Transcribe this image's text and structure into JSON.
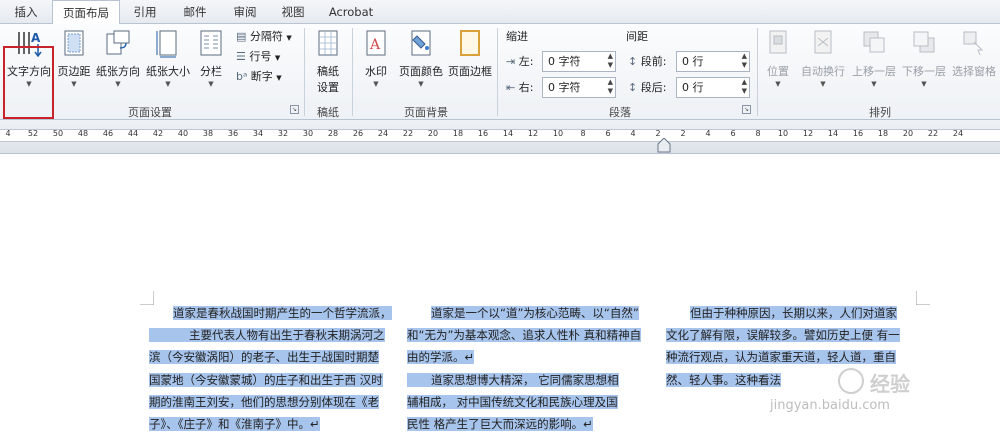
{
  "tabs": [
    "插入",
    "页面布局",
    "引用",
    "邮件",
    "审阅",
    "视图",
    "Acrobat"
  ],
  "active_tab": "页面布局",
  "page_setup": {
    "text_direction": "文字方向",
    "margins": "页边距",
    "orientation": "纸张方向",
    "size": "纸张大小",
    "columns": "分栏",
    "breaks": "分隔符",
    "line_numbers": "行号",
    "hyphenation": "断字",
    "label": "页面设置"
  },
  "manuscript": {
    "button_line1": "稿纸",
    "button_line2": "设置",
    "label": "稿纸"
  },
  "page_background": {
    "watermark": "水印",
    "page_color": "页面颜色",
    "page_borders": "页面边框",
    "label": "页面背景"
  },
  "paragraph": {
    "indent_title": "缩进",
    "spacing_title": "间距",
    "left_label": "左:",
    "left_value": "0 字符",
    "right_label": "右:",
    "right_value": "0 字符",
    "before_label": "段前:",
    "before_value": "0 行",
    "after_label": "段后:",
    "after_value": "0 行",
    "label": "段落"
  },
  "arrange": {
    "position": "位置",
    "wrap": "自动换行",
    "bring_forward": "上移一层",
    "send_backward": "下移一层",
    "selection_pane": "选择窗格",
    "label": "排列"
  },
  "ruler_numbers": [
    "4",
    "52",
    "50",
    "48",
    "46",
    "44",
    "42",
    "40",
    "38",
    "36",
    "34",
    "32",
    "30",
    "28",
    "26",
    "24",
    "22",
    "20",
    "18",
    "16",
    "14",
    "12",
    "10",
    "8",
    "6",
    "4",
    "2",
    "2",
    "4",
    "6",
    "8",
    "10",
    "12",
    "14",
    "16",
    "18",
    "20",
    "22",
    "24"
  ],
  "document": {
    "col1": [
      "道家是春秋战国时期产生的一个哲学流派，",
      "主要代表人物有出生于春秋末期涡河之",
      "滨（今安徽涡阳）的老子、出生于战国时期楚",
      "国蒙地（今安徽蒙城）的庄子和出生于西 汉时",
      "期的淮南王刘安，他们的思想分别体现在《老",
      "子》、《庄子》和《淮南子》中。↵"
    ],
    "col2": [
      "道家是一个以“道”为核心范畴、以“自然”",
      "和“无为”为基本观念、追求人性朴 真和精神自",
      "由的学派。↵",
      "道家思想博大精深，      它同儒家思想相",
      "辅相成，      对中国传统文化和民族心理及国",
      "民性 格产生了巨大而深远的影响。↵"
    ],
    "col3": [
      "但由于种种原因，长期以来，人们对道家",
      "文化了解有限，误解较多。譬如历史上便 有一",
      "种流行观点，认为道家重天道，轻人道，重自",
      "然、轻人事。这种看法",
      "",
      ""
    ]
  },
  "watermark": {
    "brand": "经验",
    "url": "jingyan.baidu.com"
  },
  "colors": {
    "selection": "#a7c4ec",
    "highlight_box": "#c8222a",
    "ribbon_bg": "#eef1f5"
  }
}
